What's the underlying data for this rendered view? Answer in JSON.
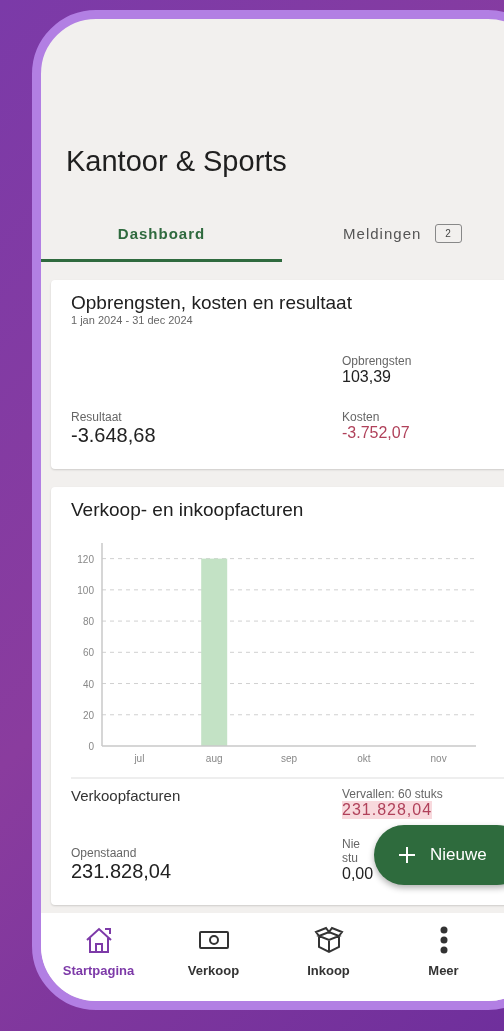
{
  "title": "Kantoor & Sports",
  "tabs": [
    {
      "label": "Dashboard",
      "selected": true
    },
    {
      "label": "Meldingen",
      "selected": false,
      "badge": "2"
    }
  ],
  "summary_card": {
    "title": "Opbrengsten, kosten en resultaat",
    "period": "1 jan 2024 - 31 dec 2024",
    "revenue": {
      "label": "Opbrengsten",
      "value": "103,39"
    },
    "result": {
      "label": "Resultaat",
      "value": "-3.648,68"
    },
    "costs": {
      "label": "Kosten",
      "value": "-3.752,07"
    }
  },
  "invoices_card": {
    "title": "Verkoop- en inkoopfacturen",
    "chart_data": {
      "type": "bar",
      "categories": [
        "jul",
        "aug",
        "sep",
        "okt",
        "nov"
      ],
      "values": [
        0,
        120,
        0,
        0,
        0
      ],
      "ylim": [
        0,
        130
      ],
      "yticks": [
        0,
        20,
        40,
        60,
        80,
        100,
        120
      ],
      "grid": true
    },
    "section_title": "Verkoopfacturen",
    "overdue": {
      "label": "Vervallen: 60 stuks",
      "value": "231.828,04"
    },
    "open": {
      "label": "Openstaand",
      "value": "231.828,04"
    },
    "not_due": {
      "label_lines": [
        "Nie",
        "stu"
      ],
      "value": "0,00"
    }
  },
  "fab": {
    "label": "Nieuwe"
  },
  "bottom_nav": [
    {
      "label": "Startpagina",
      "selected": true
    },
    {
      "label": "Verkoop",
      "selected": false
    },
    {
      "label": "Inkoop",
      "selected": false
    },
    {
      "label": "Meer",
      "selected": false
    }
  ]
}
